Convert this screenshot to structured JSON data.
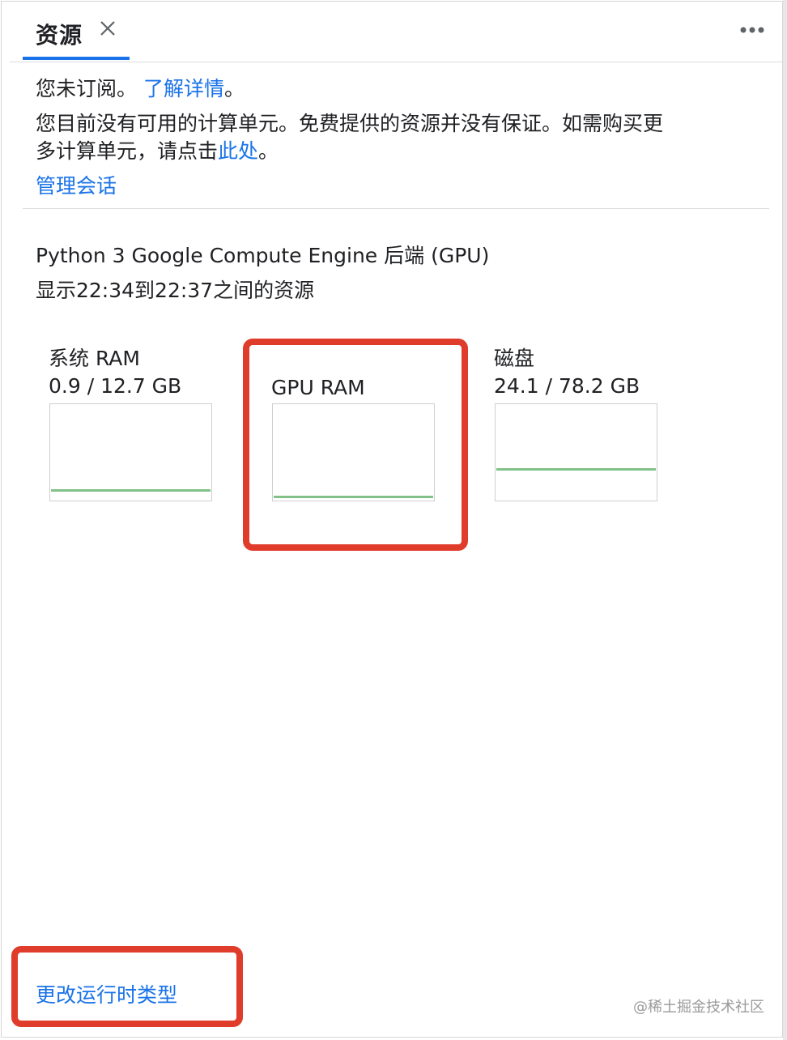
{
  "tab": {
    "label": "资源"
  },
  "subscription": {
    "not_subscribed": "您未订阅。",
    "learn_more": "了解详情",
    "learn_more_suffix": "。",
    "no_units_line1": "您目前没有可用的计算单元。免费提供的资源并没有保证。如需购买更",
    "no_units_line2_pre": "多计算单元，请点击",
    "click_here": "此处",
    "no_units_line2_post": "。",
    "manage_sessions": "管理会话"
  },
  "backend": {
    "name": "Python 3 Google Compute Engine 后端 (GPU)",
    "range": "显示22:34到22:37之间的资源"
  },
  "resources": {
    "system_ram": {
      "label": "系统 RAM",
      "usage": "0.9 / 12.7 GB",
      "used": 0.9,
      "total": 12.7
    },
    "gpu_ram": {
      "label": "GPU RAM",
      "used": 0
    },
    "disk": {
      "label": "磁盘",
      "usage": "24.1 / 78.2 GB",
      "used": 24.1,
      "total": 78.2
    }
  },
  "footer": {
    "change_runtime": "更改运行时类型"
  },
  "watermark": "@稀土掘金技术社区",
  "colors": {
    "accent": "#1a73e8",
    "highlight": "#e03c2b",
    "chart_line": "#82c289"
  }
}
